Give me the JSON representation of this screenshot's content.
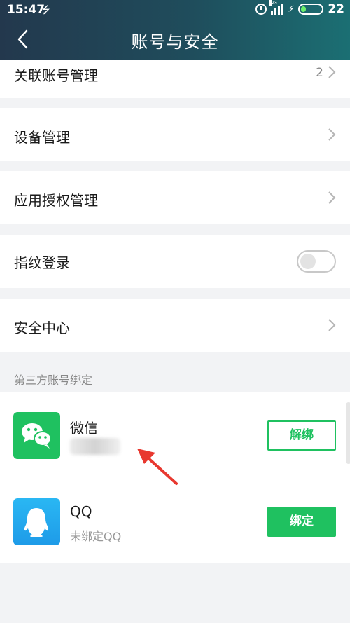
{
  "status_bar": {
    "time": "15:47",
    "network": "4G",
    "battery": "22"
  },
  "header": {
    "title": "账号与安全"
  },
  "menu": {
    "linked_accounts": {
      "label": "关联账号管理",
      "count": "2"
    },
    "device_management": {
      "label": "设备管理"
    },
    "app_authorization": {
      "label": "应用授权管理"
    },
    "fingerprint_login": {
      "label": "指纹登录",
      "enabled": false
    },
    "security_center": {
      "label": "安全中心"
    }
  },
  "third_party": {
    "section_title": "第三方账号绑定",
    "wechat": {
      "name": "微信",
      "button": "解绑"
    },
    "qq": {
      "name": "QQ",
      "status": "未绑定QQ",
      "button": "绑定"
    }
  },
  "colors": {
    "accent_green": "#1fc160",
    "header_left": "#23384d",
    "header_right": "#1b6f73",
    "annotation_arrow": "#e8382f"
  }
}
